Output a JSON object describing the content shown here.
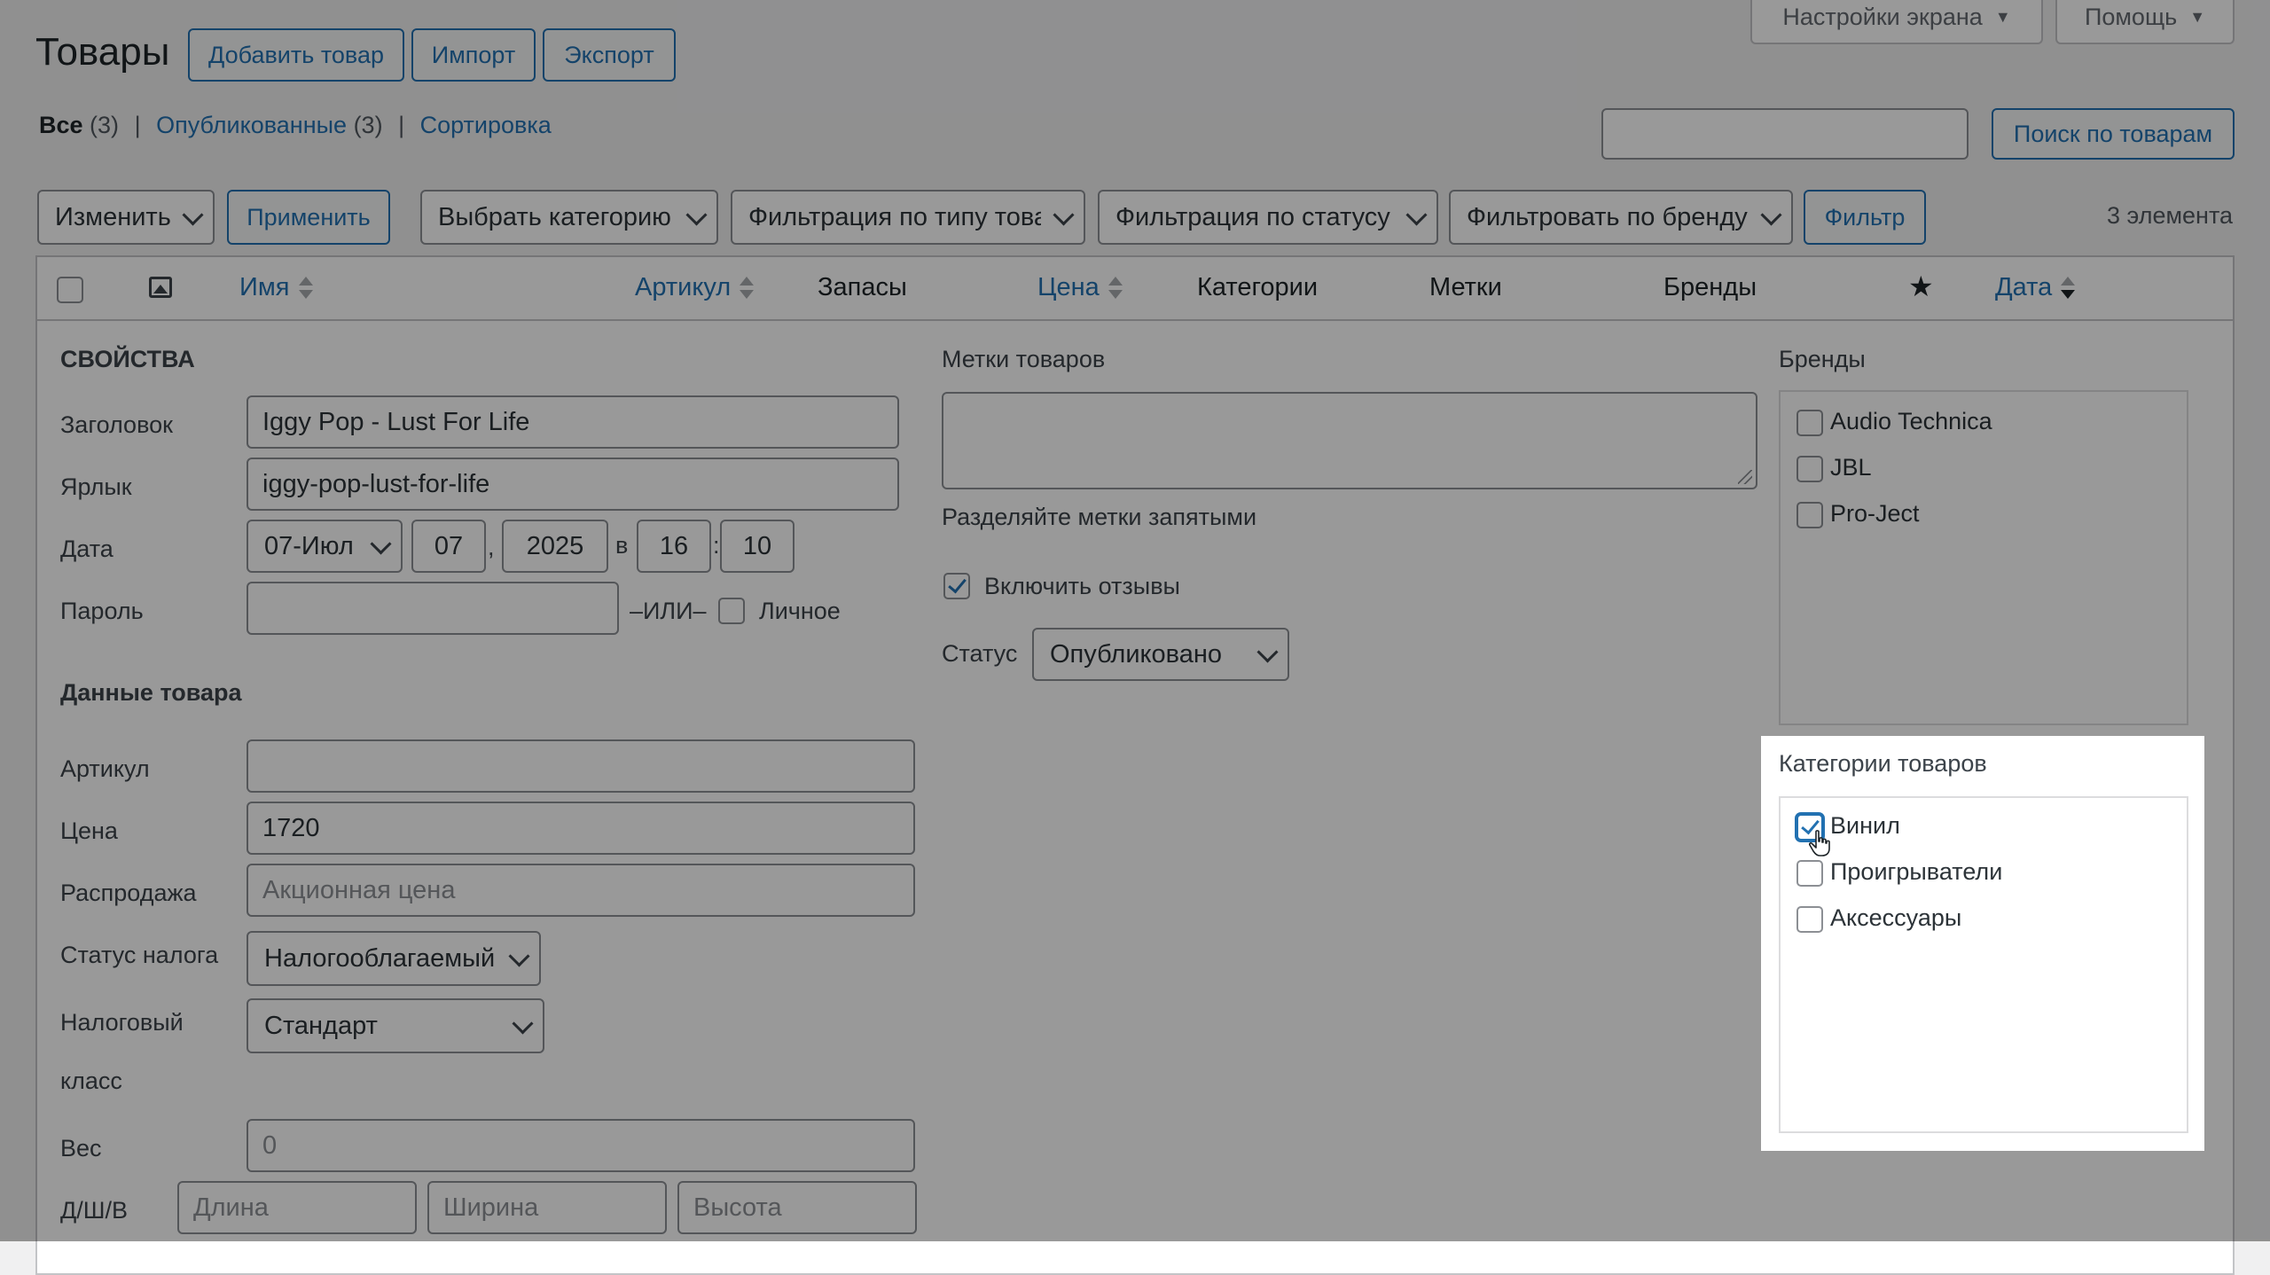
{
  "page": {
    "title": "Товары",
    "add_button": "Добавить товар",
    "import_button": "Импорт",
    "export_button": "Экспорт",
    "screen_options": "Настройки экрана",
    "help": "Помощь"
  },
  "views": {
    "all": "Все",
    "all_count": "(3)",
    "published": "Опубликованные",
    "published_count": "(3)",
    "sorting": "Сортировка",
    "sep": "|"
  },
  "search": {
    "value": "",
    "button": "Поиск по товарам"
  },
  "filters": {
    "bulk_action": "Изменить",
    "apply": "Применить",
    "category": "Выбрать категорию",
    "type": "Фильтрация по типу товара",
    "status": "Фильтрация по статусу",
    "brand": "Фильтровать по бренду",
    "filter_button": "Фильтр",
    "count": "3 элемента"
  },
  "columns": {
    "name": "Имя",
    "sku": "Артикул",
    "stock": "Запасы",
    "price": "Цена",
    "categories": "Категории",
    "tags": "Метки",
    "brands": "Бренды",
    "date": "Дата"
  },
  "quick_edit": {
    "heading": "СВОЙСТВА",
    "title_label": "Заголовок",
    "title_value": "Iggy Pop - Lust For Life",
    "slug_label": "Ярлык",
    "slug_value": "iggy-pop-lust-for-life",
    "date_label": "Дата",
    "date_month": "07-Июл",
    "date_day": "07",
    "date_comma": ",",
    "date_year": "2025",
    "date_at": "в",
    "date_hour": "16",
    "date_colon": ":",
    "date_min": "10",
    "password_label": "Пароль",
    "or": "–ИЛИ–",
    "private": "Личное",
    "product_data": "Данные товара",
    "sku_label": "Артикул",
    "price_label": "Цена",
    "price_value": "1720",
    "sale_label": "Распродажа",
    "sale_placeholder": "Акционная цена",
    "tax_status_label": "Статус налога",
    "tax_status_value": "Налогооблагаемый",
    "tax_class_label_1": "Налоговый",
    "tax_class_label_2": "класс",
    "tax_class_value": "Стандарт",
    "weight_label": "Вес",
    "weight_placeholder": "0",
    "dims_label": "Д/Ш/В",
    "length_placeholder": "Длина",
    "width_placeholder": "Ширина",
    "height_placeholder": "Высота"
  },
  "tags_panel": {
    "label": "Метки товаров",
    "hint": "Разделяйте метки запятыми",
    "reviews": "Включить отзывы",
    "status_label": "Статус",
    "status_value": "Опубликовано"
  },
  "brands_panel": {
    "label": "Бренды",
    "items": [
      "Audio Technica",
      "JBL",
      "Pro-Ject"
    ]
  },
  "categories_panel": {
    "label": "Категории товаров",
    "items": [
      "Винил",
      "Проигрыватели",
      "Аксессуары"
    ]
  }
}
